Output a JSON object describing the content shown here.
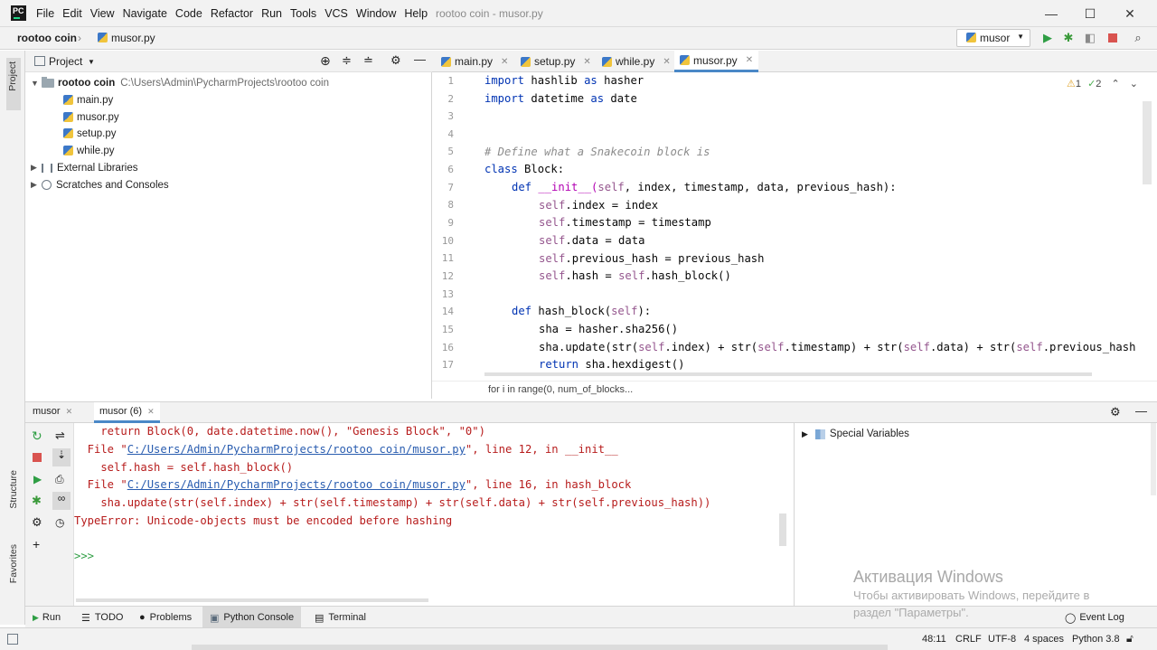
{
  "titlebar": {
    "logo": "PC",
    "menu": [
      "File",
      "Edit",
      "View",
      "Navigate",
      "Code",
      "Refactor",
      "Run",
      "Tools",
      "VCS",
      "Window",
      "Help"
    ],
    "window_title": "rootoo coin - musor.py",
    "minimize": "—",
    "maximize": "☐",
    "close": "✕"
  },
  "navbar": {
    "project": "rootoo coin",
    "file": "musor.py",
    "run_config": "musor"
  },
  "left_strip": {
    "project_label": "Project",
    "structure_label": "Structure",
    "favorites_label": "Favorites"
  },
  "project_panel": {
    "title": "Project",
    "root_name": "rootoo coin",
    "root_path": "C:\\Users\\Admin\\PycharmProjects\\rootoo coin",
    "files": [
      "main.py",
      "musor.py",
      "setup.py",
      "while.py"
    ],
    "external": "External Libraries",
    "scratches": "Scratches and Consoles"
  },
  "editor": {
    "tabs": [
      "main.py",
      "setup.py",
      "while.py",
      "musor.py"
    ],
    "inspections": {
      "warnings": "1",
      "weak": "2"
    },
    "line_numbers": [
      "1",
      "2",
      "3",
      "4",
      "5",
      "6",
      "7",
      "8",
      "9",
      "10",
      "11",
      "12",
      "13",
      "14",
      "15",
      "16",
      "17"
    ],
    "code": {
      "l1_kw": "import",
      "l1_rest": " hashlib ",
      "l1_as": "as",
      "l1_name": " hasher",
      "l2_kw": "import",
      "l2_rest": " datetime ",
      "l2_as": "as",
      "l2_name": " date",
      "l5": "# Define what a Snakecoin block is",
      "l6_kw": "class",
      "l6_rest": " Block:",
      "l7_kw": "def",
      "l7_fn": " __init__(",
      "l7_self": "self",
      "l7_rest": ", index, timestamp, data, previous_hash):",
      "l8_self": "self",
      "l8_rest": ".index = index",
      "l9_self": "self",
      "l9_rest": ".timestamp = timestamp",
      "l10_self": "self",
      "l10_rest": ".data = data",
      "l11_self": "self",
      "l11_rest": ".previous_hash = previous_hash",
      "l12_self": "self",
      "l12_mid": ".hash = ",
      "l12_self2": "self",
      "l12_rest": ".hash_block()",
      "l14_kw": "def",
      "l14_fn": " hash_block(",
      "l14_self": "self",
      "l14_rest": "):",
      "l15": "sha = hasher.sha256()",
      "l16_a": "sha.update(str(",
      "l16_s1": "self",
      "l16_b": ".index) + str(",
      "l16_s2": "self",
      "l16_c": ".timestamp) + str(",
      "l16_s3": "self",
      "l16_d": ".data) + str(",
      "l16_s4": "self",
      "l16_e": ".previous_hash",
      "l17_kw": "return",
      "l17_rest": " sha.hexdigest()"
    },
    "breadcrumb": "for i in range(0, num_of_blocks..."
  },
  "console": {
    "tabs": [
      "musor",
      "musor (6)"
    ],
    "lines": {
      "c1": "    return Block(0, date.datetime.now(), \"Genesis Block\", \"0\")",
      "c2_pre": "  File \"",
      "c2_link": "C:/Users/Admin/PycharmProjects/rootoo coin/musor.py",
      "c2_post": "\", line 12, in __init__",
      "c3": "    self.hash = self.hash_block()",
      "c4_pre": "  File \"",
      "c4_link": "C:/Users/Admin/PycharmProjects/rootoo coin/musor.py",
      "c4_post": "\", line 16, in hash_block",
      "c5": "    sha.update(str(self.index) + str(self.timestamp) + str(self.data) + str(self.previous_hash))",
      "c6": "TypeError: Unicode-objects must be encoded before hashing",
      "prompt": ">>>"
    },
    "special_variables": "Special Variables"
  },
  "bottom_tools": [
    "Run",
    "TODO",
    "Problems",
    "Python Console",
    "Terminal"
  ],
  "event_log": "Event Log",
  "status": {
    "position": "48:11",
    "line_sep": "CRLF",
    "encoding": "UTF-8",
    "indent": "4 spaces",
    "interpreter": "Python 3.8"
  },
  "watermark": {
    "title": "Активация Windows",
    "line1": "Чтобы активировать Windows, перейдите в",
    "line2": "раздел \"Параметры\"."
  }
}
